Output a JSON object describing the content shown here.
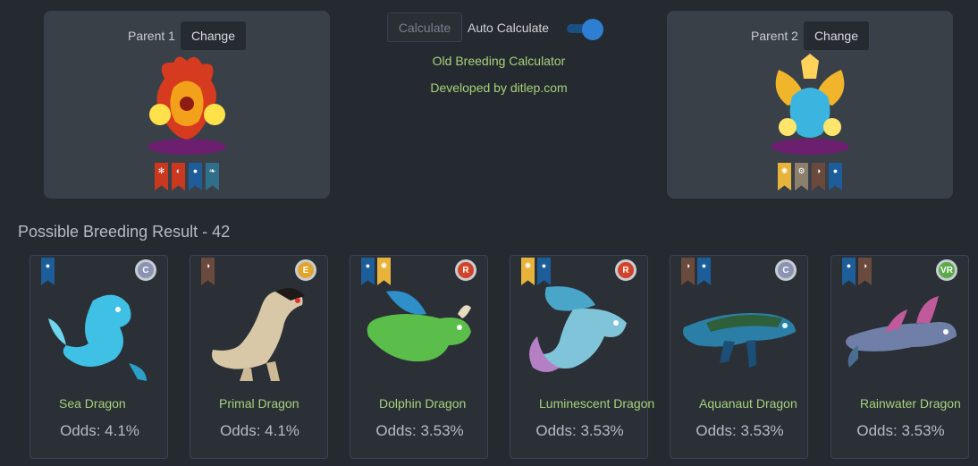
{
  "parents": [
    {
      "label": "Parent 1",
      "change_label": "Change",
      "elements": [
        "fire-element-icon",
        "war-element-icon",
        "water-element-icon",
        "wind-element-icon"
      ]
    },
    {
      "label": "Parent 2",
      "change_label": "Change",
      "elements": [
        "light-element-icon",
        "metal-element-icon",
        "dark-element-icon",
        "water-element-icon"
      ]
    }
  ],
  "controls": {
    "calculate_label": "Calculate",
    "auto_calculate_label": "Auto Calculate",
    "auto_calculate_on": true,
    "old_calculator_link": "Old Breeding Calculator",
    "developer_link": "Developed by ditlep.com"
  },
  "results": {
    "title": "Possible Breeding Result - 42",
    "items": [
      {
        "name": "Sea Dragon",
        "odds": "Odds: 4.1%",
        "rarity": "C",
        "elements": [
          "water"
        ],
        "color": "#3fc1e6"
      },
      {
        "name": "Primal Dragon",
        "odds": "Odds: 4.1%",
        "rarity": "E",
        "elements": [
          "primal"
        ],
        "color": "#d9c8a8"
      },
      {
        "name": "Dolphin Dragon",
        "odds": "Odds: 3.53%",
        "rarity": "R",
        "elements": [
          "water",
          "light"
        ],
        "color": "#5bbd4a"
      },
      {
        "name": "Luminescent Dragon",
        "odds": "Odds: 3.53%",
        "rarity": "R",
        "elements": [
          "light",
          "water"
        ],
        "color": "#7fc4d8"
      },
      {
        "name": "Aquanaut Dragon",
        "odds": "Odds: 3.53%",
        "rarity": "C",
        "elements": [
          "primal",
          "water"
        ],
        "color": "#2b7fa6"
      },
      {
        "name": "Rainwater Dragon",
        "odds": "Odds: 3.53%",
        "rarity": "VR",
        "elements": [
          "water",
          "primal"
        ],
        "color": "#6f7fa8"
      }
    ]
  }
}
